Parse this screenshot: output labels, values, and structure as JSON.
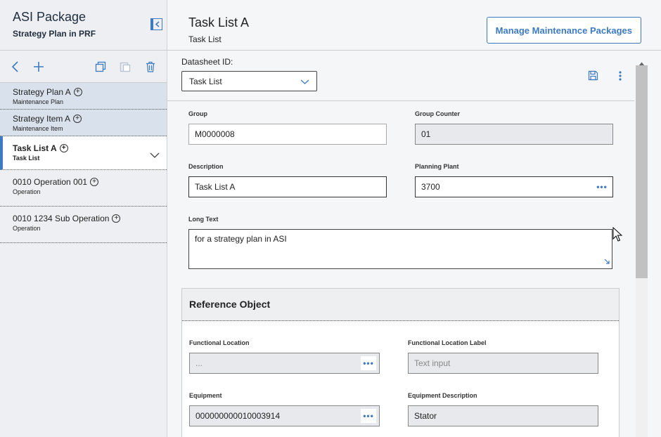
{
  "sidebar": {
    "title": "ASI Package",
    "subtitle": "Strategy Plan in PRF",
    "items": [
      {
        "label": "Strategy Plan A",
        "type": "Maintenance Plan"
      },
      {
        "label": "Strategy Item A",
        "type": "Maintenance Item"
      },
      {
        "label": "Task List A",
        "type": "Task List"
      },
      {
        "label": "0010 Operation 001",
        "type": "Operation"
      },
      {
        "label": "0010 1234 Sub Operation",
        "type": "Operation"
      }
    ]
  },
  "main": {
    "title": "Task List A",
    "subtitle": "Task List",
    "manage_button": "Manage Maintenance Packages",
    "datasheet": {
      "label": "Datasheet ID:",
      "value": "Task List"
    },
    "fields": {
      "group": {
        "label": "Group",
        "value": "M0000008"
      },
      "group_counter": {
        "label": "Group Counter",
        "value": "01"
      },
      "description": {
        "label": "Description",
        "value": "Task List A"
      },
      "planning_plant": {
        "label": "Planning Plant",
        "value": "3700"
      },
      "long_text": {
        "label": "Long Text",
        "value": "for a strategy plan in ASI"
      }
    },
    "reference": {
      "title": "Reference Object",
      "functional_location": {
        "label": "Functional Location",
        "value": "..."
      },
      "functional_location_label": {
        "label": "Functional Location Label",
        "placeholder": "Text input"
      },
      "equipment": {
        "label": "Equipment",
        "value": "000000000010003914"
      },
      "equipment_description": {
        "label": "Equipment Description",
        "value": "Stator"
      }
    }
  },
  "colors": {
    "accent": "#3d7ac2",
    "sidebar_bg": "#edeff2",
    "parent_bg": "#d9e2ec"
  }
}
